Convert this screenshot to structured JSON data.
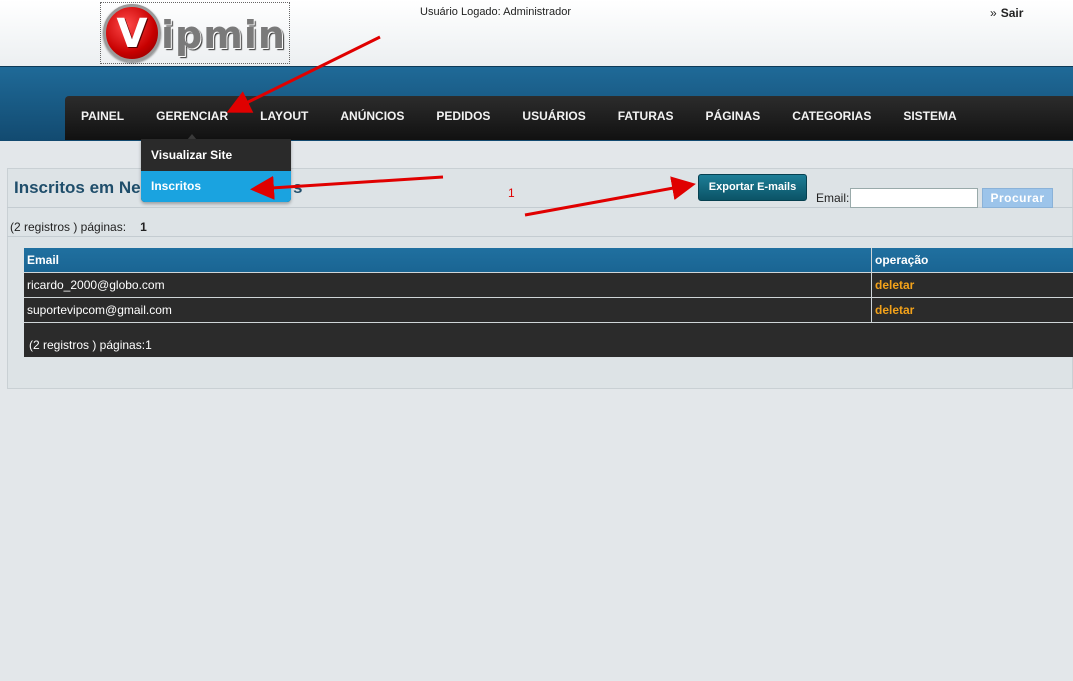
{
  "header": {
    "logo_text": "ipmin",
    "logo_letter": "V",
    "user_logged": "Usuário Logado: Administrador",
    "logout_prefix": "»",
    "logout_label": "Sair"
  },
  "nav": {
    "items": [
      {
        "label": "PAINEL"
      },
      {
        "label": "GERENCIAR"
      },
      {
        "label": "LAYOUT"
      },
      {
        "label": "ANÚNCIOS"
      },
      {
        "label": "PEDIDOS"
      },
      {
        "label": "USUÁRIOS"
      },
      {
        "label": "FATURAS"
      },
      {
        "label": "PÁGINAS"
      },
      {
        "label": "CATEGORIAS"
      },
      {
        "label": "SISTEMA"
      }
    ]
  },
  "dropdown": {
    "items": [
      {
        "label": "Visualizar Site"
      },
      {
        "label": "Inscritos"
      }
    ]
  },
  "page": {
    "title_visible": "Inscritos em Ne",
    "title_suffix": "s",
    "annotation_number": "1",
    "export_label": "Exportar E-mails",
    "search_label": "Email:",
    "search_value": "",
    "search_button": "Procurar",
    "pager_text": "(2 registros ) páginas:",
    "pager_number": "1"
  },
  "table": {
    "headers": {
      "email": "Email",
      "operation": "operação"
    },
    "rows": [
      {
        "email": "ricardo_2000@globo.com",
        "action": "deletar"
      },
      {
        "email": "suportevipcom@gmail.com",
        "action": "deletar"
      }
    ],
    "footer_text": "(2 registros ) páginas:",
    "footer_number": "1"
  },
  "colors": {
    "nav_band": "#1f6a98",
    "nav_bar": "#1a1a1a",
    "dropdown_selected": "#1aa3e0",
    "table_header": "#1f6c9c",
    "row_bg": "#2b2b2b",
    "action_link": "#f3a21a",
    "annotation_red": "#e00000"
  }
}
